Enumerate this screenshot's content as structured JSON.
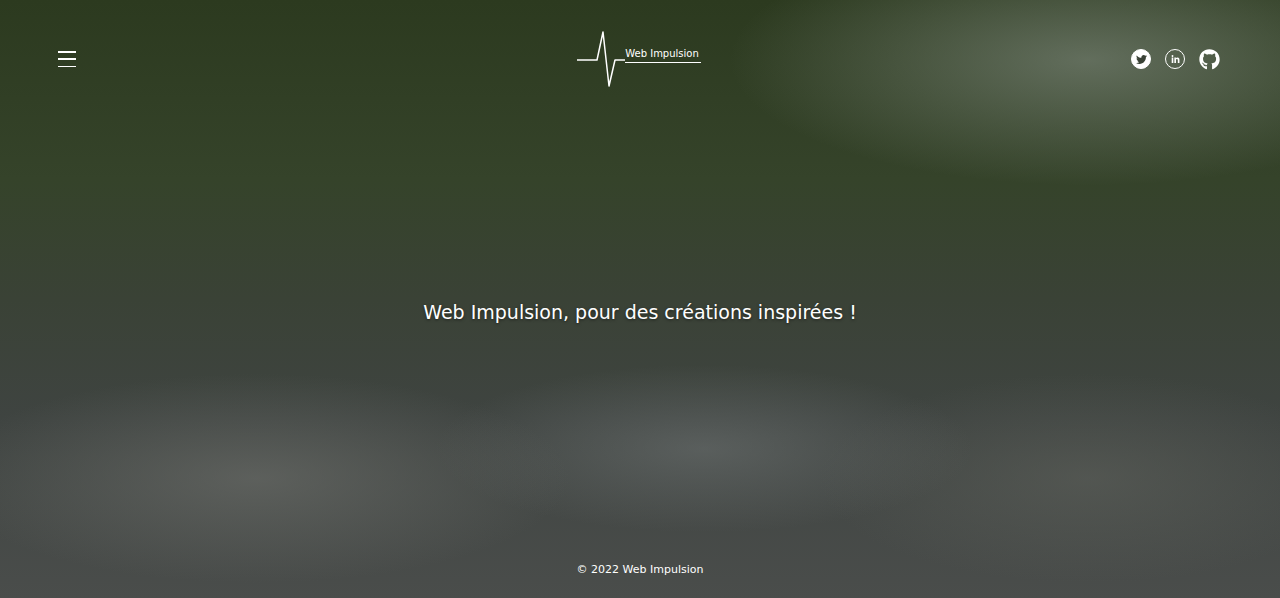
{
  "header": {
    "logo": "Web Impulsion"
  },
  "hero": {
    "title": "Web Impulsion, pour des créations inspirées !"
  },
  "footer": {
    "copyright": "© 2022 Web Impulsion"
  }
}
